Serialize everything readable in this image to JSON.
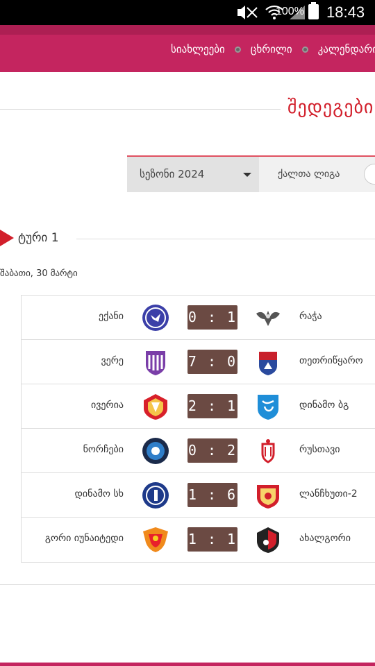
{
  "status_bar": {
    "battery_pct": "100%",
    "time": "18:43"
  },
  "nav": {
    "items": [
      {
        "label": "სიახლეები"
      },
      {
        "label": "ცხრილი"
      },
      {
        "label": "კალენდარი"
      }
    ]
  },
  "page": {
    "title": "შედეგები"
  },
  "filters": {
    "season": "სეზონი 2024",
    "league": "ქალთა ლიგა"
  },
  "round": {
    "label": "ტური 1",
    "date": "შაბათი, 30 მარტი"
  },
  "matches": [
    {
      "home": "ექანი",
      "score": "0 : 1",
      "away": "რაჭა"
    },
    {
      "home": "ვერე",
      "score": "7 : 0",
      "away": "თეთრიწყარო"
    },
    {
      "home": "ივერია",
      "score": "2 : 1",
      "away": "დინამო ბგ"
    },
    {
      "home": "ნორჩები",
      "score": "0 : 2",
      "away": "რუსთავი"
    },
    {
      "home": "დინამო სხ",
      "score": "1 : 6",
      "away": "ლანჩხუთი-2"
    },
    {
      "home": "გორი იუნაიტედი",
      "score": "1 : 1",
      "away": "ახალგორი"
    }
  ],
  "colors": {
    "brand": "#c4255f",
    "accent_red": "#d21f2b",
    "score_bg": "#6b4a43"
  }
}
